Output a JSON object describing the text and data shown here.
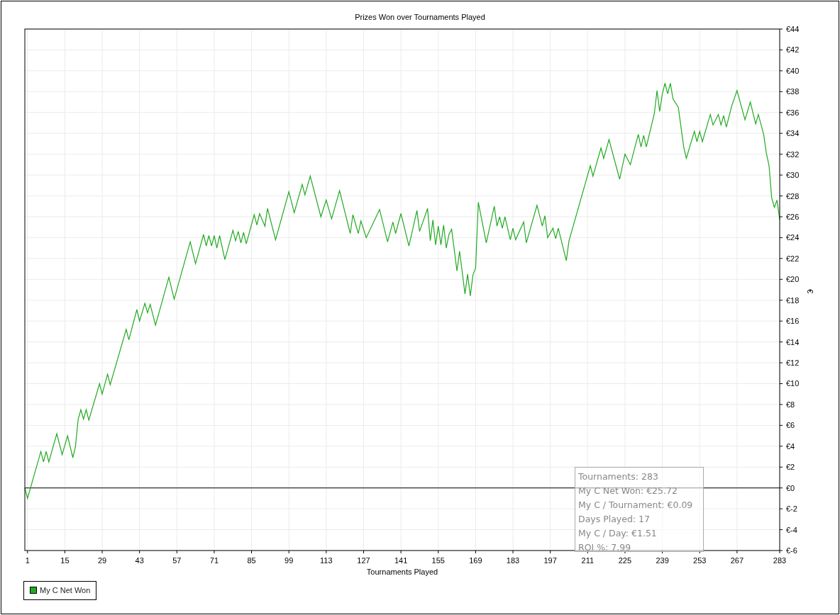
{
  "title": "Prizes Won over Tournaments Played",
  "chart": {
    "chart_data": {
      "type": "line",
      "grid": true,
      "xlabel": "Tournaments Played",
      "ylabel": "€",
      "xlim": [
        0,
        283
      ],
      "ylim": [
        -6,
        44
      ],
      "xticks": [
        1,
        15,
        29,
        43,
        57,
        71,
        85,
        99,
        113,
        127,
        141,
        155,
        169,
        183,
        197,
        211,
        225,
        239,
        253,
        267,
        283
      ],
      "yticks": [
        {
          "value": 44,
          "label": "€44"
        },
        {
          "value": 42,
          "label": "€42"
        },
        {
          "value": 40,
          "label": "€40"
        },
        {
          "value": 38,
          "label": "€38"
        },
        {
          "value": 36,
          "label": "€36"
        },
        {
          "value": 34,
          "label": "€34"
        },
        {
          "value": 32,
          "label": "€32"
        },
        {
          "value": 30,
          "label": "€30"
        },
        {
          "value": 28,
          "label": "€28"
        },
        {
          "value": 26,
          "label": "€26"
        },
        {
          "value": 24,
          "label": "€24"
        },
        {
          "value": 22,
          "label": "€22"
        },
        {
          "value": 20,
          "label": "€20"
        },
        {
          "value": 18,
          "label": "€18"
        },
        {
          "value": 16,
          "label": "€16"
        },
        {
          "value": 14,
          "label": "€14"
        },
        {
          "value": 12,
          "label": "€12"
        },
        {
          "value": 10,
          "label": "€10"
        },
        {
          "value": 8,
          "label": "€8"
        },
        {
          "value": 6,
          "label": "€6"
        },
        {
          "value": 4,
          "label": "€4"
        },
        {
          "value": 2,
          "label": "€2"
        },
        {
          "value": 0,
          "label": "€0"
        },
        {
          "value": -2,
          "label": "€-2"
        },
        {
          "value": -4,
          "label": "€-4"
        },
        {
          "value": -6,
          "label": "€-6"
        }
      ],
      "x": [
        0,
        1,
        6,
        7,
        8,
        9,
        12,
        14,
        16,
        18,
        19,
        20,
        21,
        22,
        23,
        24,
        28,
        29,
        31,
        32,
        38,
        39,
        42,
        43,
        45,
        46,
        47,
        49,
        54,
        56,
        62,
        64,
        67,
        68,
        69,
        70,
        71,
        72,
        73,
        75,
        78,
        79,
        80,
        81,
        82,
        83,
        86,
        87,
        88,
        90,
        91,
        94,
        99,
        101,
        104,
        105,
        107,
        111,
        113,
        115,
        118,
        122,
        123,
        125,
        126,
        128,
        133,
        136,
        138,
        139,
        141,
        144,
        147,
        148,
        151,
        152,
        153,
        154,
        155,
        156,
        157,
        158,
        159,
        160,
        162,
        163,
        165,
        166,
        167,
        168,
        169,
        170,
        173,
        176,
        177,
        178,
        179,
        180,
        182,
        183,
        184,
        187,
        188,
        192,
        194,
        195,
        196,
        198,
        199,
        200,
        203,
        204,
        212,
        213,
        216,
        217,
        219,
        223,
        225,
        227,
        230,
        231,
        232,
        233,
        236,
        237,
        238,
        239,
        240,
        241,
        242,
        243,
        245,
        247,
        248,
        251,
        252,
        253,
        254,
        257,
        258,
        260,
        261,
        262,
        263,
        265,
        267,
        270,
        272,
        274,
        275,
        277,
        278,
        279,
        280,
        281,
        282,
        283
      ],
      "series": [
        {
          "name": "My C Net Won",
          "color": "#22aa22",
          "values": [
            0,
            -1,
            3.5,
            2.5,
            3.5,
            2.5,
            5.2,
            3.2,
            5.0,
            2.9,
            4.0,
            6.6,
            7.5,
            6.6,
            7.5,
            6.5,
            10.0,
            9.0,
            10.9,
            9.9,
            15.2,
            14.2,
            17.1,
            16.0,
            17.7,
            16.8,
            17.6,
            15.6,
            20.2,
            18.1,
            23.6,
            21.5,
            24.3,
            23.2,
            24.2,
            23.2,
            24.2,
            23.0,
            24.2,
            21.9,
            24.7,
            23.7,
            24.6,
            23.5,
            24.5,
            23.4,
            26.2,
            25.2,
            26.3,
            25.1,
            26.8,
            23.8,
            28.4,
            26.4,
            29.1,
            28.1,
            29.9,
            26.0,
            27.6,
            25.8,
            28.5,
            24.4,
            26.2,
            24.4,
            25.6,
            24.0,
            26.7,
            23.6,
            25.5,
            24.4,
            26.3,
            23.2,
            26.6,
            24.6,
            26.8,
            23.7,
            25.7,
            23.3,
            25.1,
            23.3,
            25.2,
            23.0,
            24.3,
            24.8,
            20.8,
            22.7,
            18.6,
            20.5,
            18.4,
            20.4,
            21.1,
            27.4,
            23.5,
            27.0,
            25.1,
            26.0,
            24.9,
            26.0,
            23.8,
            24.9,
            23.8,
            25.5,
            23.5,
            27.1,
            25.1,
            26.1,
            24.0,
            24.9,
            23.9,
            24.9,
            21.8,
            23.7,
            30.9,
            29.9,
            32.6,
            31.6,
            33.4,
            29.6,
            32.0,
            31.0,
            33.9,
            32.7,
            33.8,
            32.7,
            35.9,
            38.1,
            36.1,
            37.8,
            38.8,
            37.8,
            38.8,
            37.3,
            36.5,
            32.7,
            31.6,
            34.2,
            33.2,
            34.2,
            33.2,
            35.8,
            34.8,
            35.8,
            34.8,
            35.7,
            34.6,
            36.6,
            38.1,
            35.3,
            37.0,
            34.9,
            35.8,
            33.9,
            32.1,
            30.9,
            27.8,
            26.9,
            27.6,
            25.72
          ]
        }
      ]
    }
  },
  "tooltip": {
    "lines": [
      "Tournaments: 283",
      "My C Net Won: €25.72",
      "My C / Tournament: €0.09",
      "Days Played: 17",
      "My C / Day: €1.51",
      "ROI %: 7.99"
    ]
  }
}
